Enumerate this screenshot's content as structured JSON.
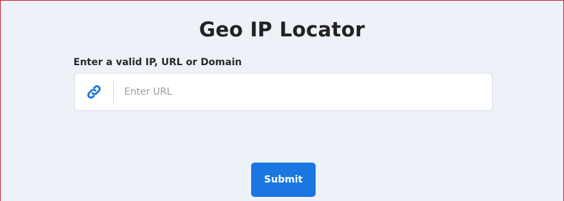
{
  "page": {
    "title": "Geo IP Locator"
  },
  "form": {
    "label": "Enter a valid IP, URL or Domain",
    "input_placeholder": "Enter URL",
    "input_value": "",
    "input_icon": "link-icon",
    "submit_label": "Submit"
  },
  "colors": {
    "background": "#edf1f8",
    "accent": "#1a76e0",
    "frame_border": "#d0242b",
    "title_text": "#222222"
  }
}
